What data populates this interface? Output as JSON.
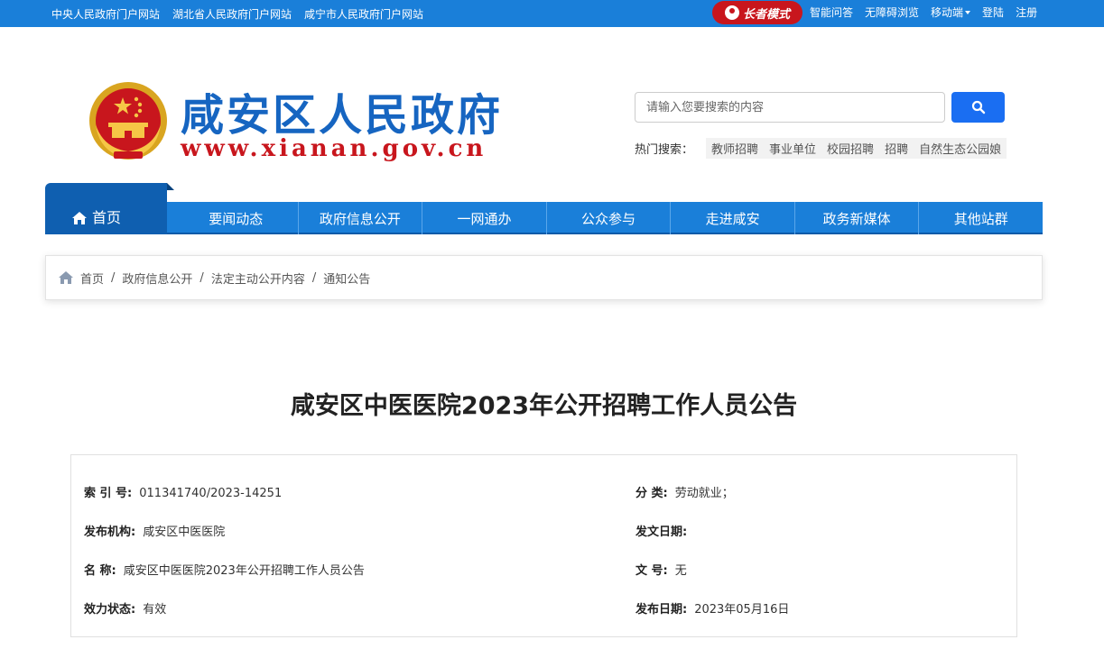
{
  "topbar": {
    "left_links": [
      "中央人民政府门户网站",
      "湖北省人民政府门户网站",
      "咸宁市人民政府门户网站"
    ],
    "elder_mode": "长者模式",
    "right_links": {
      "ai_qa": "智能问答",
      "accessible": "无障碍浏览",
      "mobile": "移动端",
      "login": "登陆",
      "register": "注册"
    }
  },
  "header": {
    "title": "咸安区人民政府",
    "domain": "www.xianan.gov.cn",
    "search_placeholder": "请输入您要搜索的内容",
    "hot_label": "热门搜索：",
    "hot_items": [
      "教师招聘",
      "事业单位",
      "校园招聘",
      "招聘",
      "自然生态公园娘"
    ]
  },
  "nav": {
    "home": "首页",
    "items": [
      "要闻动态",
      "政府信息公开",
      "一网通办",
      "公众参与",
      "走进咸安",
      "政务新媒体",
      "其他站群"
    ]
  },
  "breadcrumb": [
    "首页",
    "政府信息公开",
    "法定主动公开内容",
    "通知公告"
  ],
  "article": {
    "title": "咸安区中医医院2023年公开招聘工作人员公告"
  },
  "meta": {
    "index_label": "索 引 号:",
    "index_value": "011341740/2023-14251",
    "category_label": "分  类:",
    "category_value": "劳动就业；",
    "org_label": "发布机构:",
    "org_value": "咸安区中医医院",
    "issue_date_label": "发文日期:",
    "issue_date_value": "",
    "name_label": "名  称:",
    "name_value": "咸安区中医医院2023年公开招聘工作人员公告",
    "doc_no_label": "文  号:",
    "doc_no_value": "无",
    "status_label": "效力状态:",
    "status_value": "有效",
    "pub_date_label": "发布日期:",
    "pub_date_value": "2023年05月16日"
  },
  "colors": {
    "topbar": "#1a7fd9",
    "nav": "#1a7fd9",
    "nav_home": "#0f5fb0",
    "title_blue": "#1665c1",
    "domain_red": "#c8161d",
    "search_button": "#1a6ef2"
  }
}
